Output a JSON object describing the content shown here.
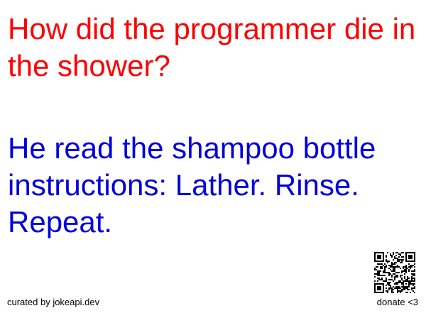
{
  "joke": {
    "setup": "How did the programmer die in the shower?",
    "delivery": "He read the shampoo bottle instructions: Lather. Rinse. Repeat."
  },
  "footer": {
    "credit": "curated by jokeapi.dev",
    "donate": "donate <3"
  },
  "colors": {
    "setup": "#ff0000",
    "delivery": "#0000dd",
    "footer": "#000000"
  },
  "icons": {
    "qr": "qr-code-icon"
  }
}
